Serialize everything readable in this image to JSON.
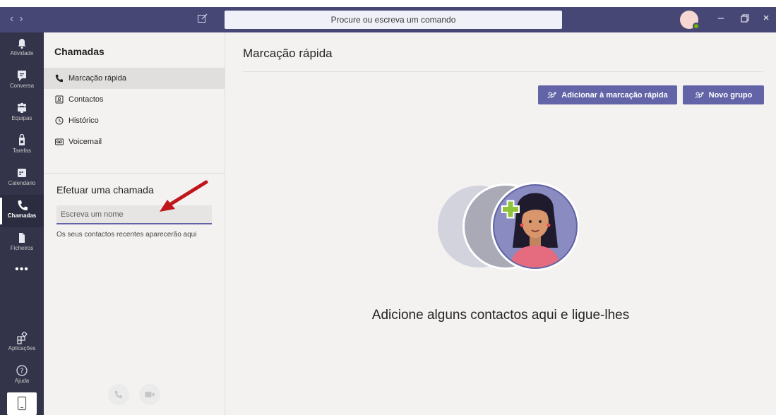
{
  "titlebar": {
    "nav_back_icon": "chevron-left-icon",
    "nav_forward_icon": "chevron-right-icon",
    "compose_icon": "compose-icon",
    "search_placeholder": "Procure ou escreva um comando",
    "window_controls": [
      "minimize-icon",
      "restore-icon",
      "close-icon"
    ],
    "colors": {
      "bar": "#464775",
      "status": "#6bb700"
    }
  },
  "rail": {
    "items": [
      {
        "label": "Atividade",
        "icon": "bell-icon"
      },
      {
        "label": "Conversa",
        "icon": "chat-icon"
      },
      {
        "label": "Equipas",
        "icon": "teams-icon"
      },
      {
        "label": "Tarefas",
        "icon": "tasks-icon"
      },
      {
        "label": "Calendário",
        "icon": "calendar-icon"
      },
      {
        "label": "Chamadas",
        "icon": "phone-icon",
        "active": true
      },
      {
        "label": "Ficheiros",
        "icon": "file-icon"
      }
    ],
    "more_label": "•••",
    "bottom": [
      {
        "label": "Aplicações",
        "icon": "apps-icon"
      },
      {
        "label": "Ajuda",
        "icon": "help-icon"
      }
    ],
    "device_icon": "device-icon"
  },
  "sidebar": {
    "title": "Chamadas",
    "nav": [
      {
        "label": "Marcação rápida",
        "icon": "phone-icon",
        "active": true
      },
      {
        "label": "Contactos",
        "icon": "contacts-icon"
      },
      {
        "label": "Histórico",
        "icon": "history-icon"
      },
      {
        "label": "Voicemail",
        "icon": "voicemail-icon"
      }
    ],
    "call_section_title": "Efetuar uma chamada",
    "name_input_placeholder": "Escreva um nome",
    "name_input_value": "",
    "recent_contacts_text": "Os seus contactos recentes aparecerão aqui",
    "call_buttons": [
      "phone-call-icon",
      "video-call-icon"
    ]
  },
  "main": {
    "title": "Marcação rápida",
    "add_speed_dial_button": "Adicionar à marcação rápida",
    "new_group_button": "Novo grupo",
    "empty_message": "Adicione alguns contactos aqui e ligue-lhes",
    "accent_color": "#6264a7"
  }
}
